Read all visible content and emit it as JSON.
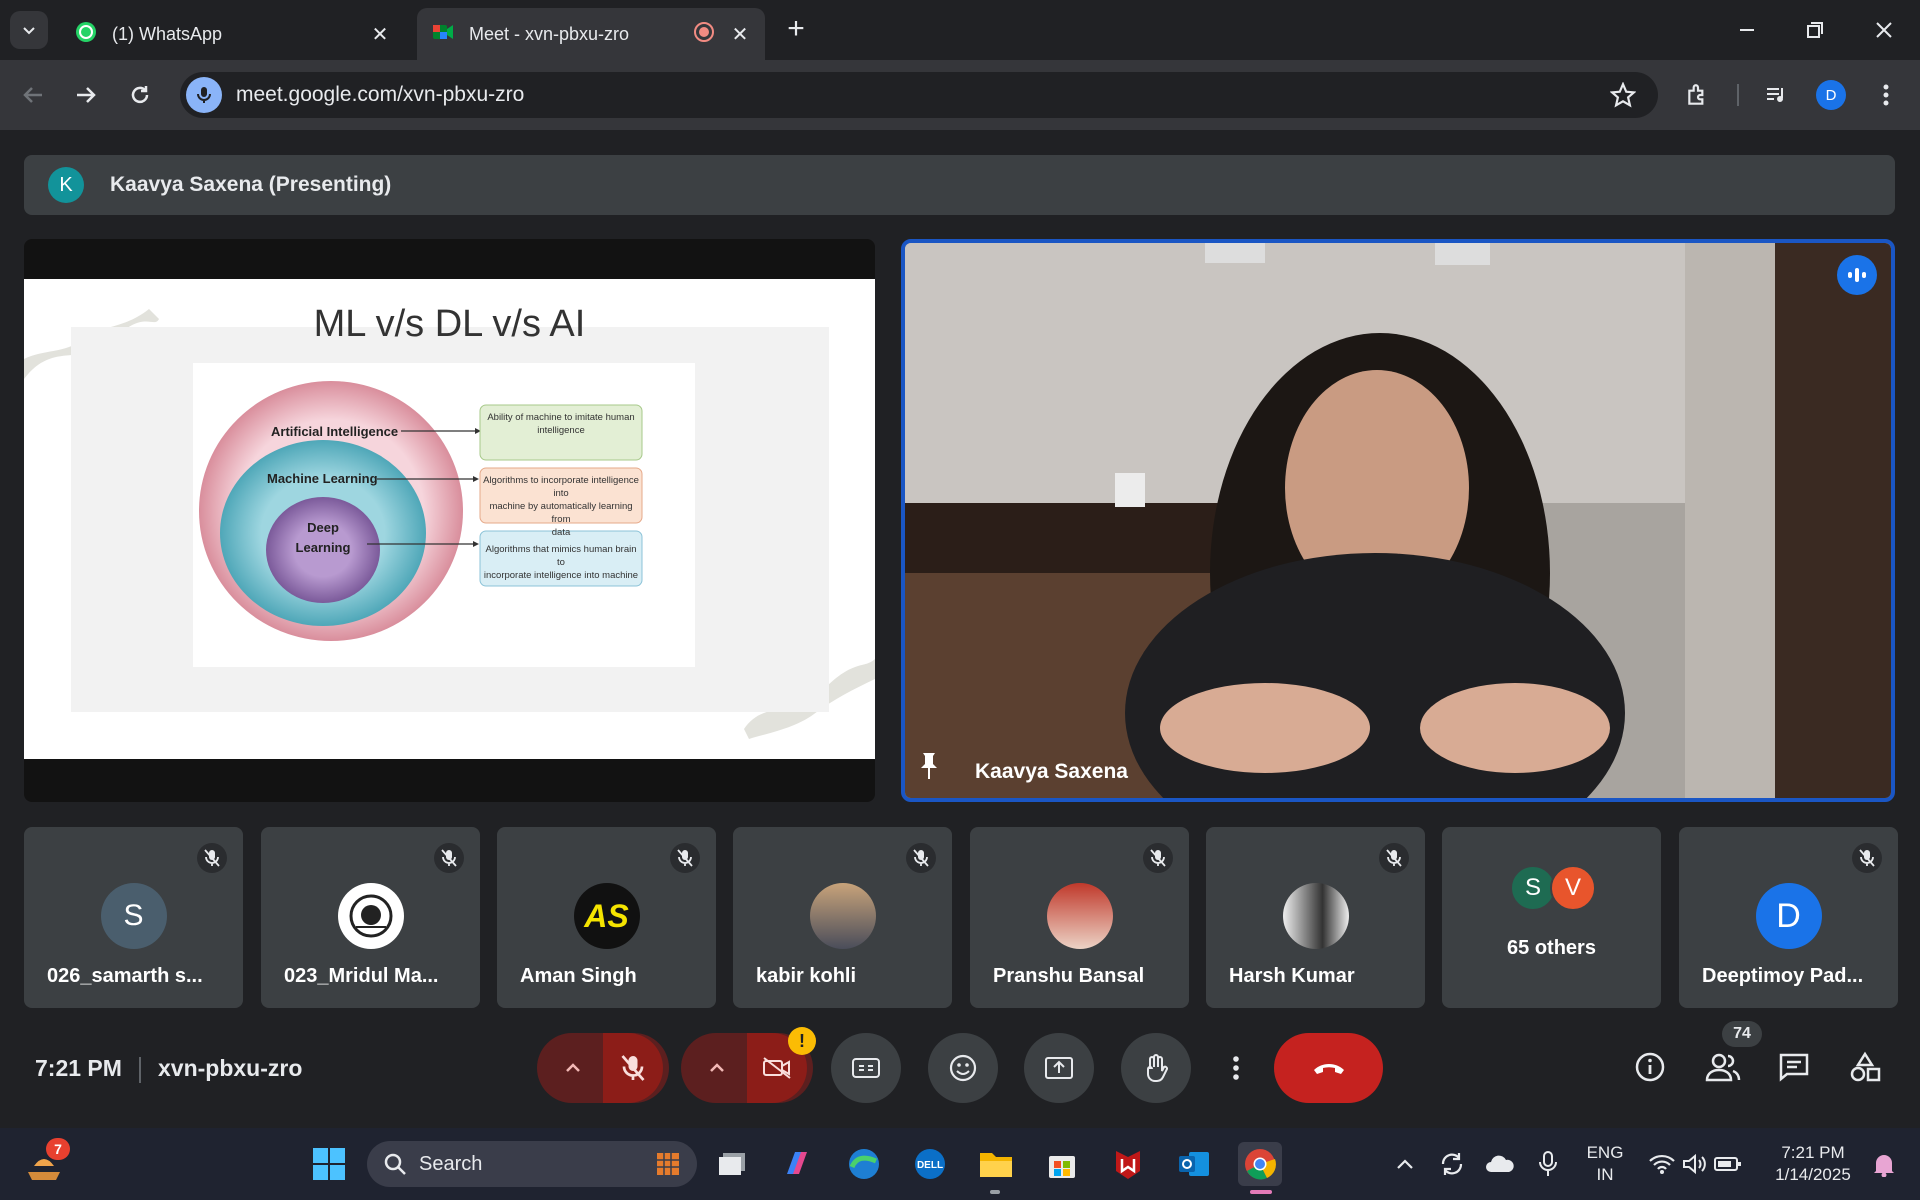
{
  "browser": {
    "tabs": [
      {
        "title": "(1) WhatsApp",
        "icon": "whatsapp-icon"
      },
      {
        "title": "Meet - xvn-pbxu-zro",
        "icon": "google-meet-icon"
      }
    ],
    "url": "meet.google.com/xvn-pbxu-zro",
    "profile_initial": "D"
  },
  "meet": {
    "presenting": {
      "initial": "K",
      "label": "Kaavya Saxena (Presenting)"
    },
    "slide": {
      "title": "ML v/s DL v/s AI",
      "rings": [
        "Artificial Intelligence",
        "Machine Learning",
        "Deep Learning"
      ],
      "deep_line1": "Deep",
      "deep_line2": "Learning",
      "boxes": [
        {
          "line1": "Ability of machine to imitate human",
          "line2": "intelligence",
          "line3": ""
        },
        {
          "line1": "Algorithms to incorporate intelligence into",
          "line2": "machine by automatically learning from",
          "line3": "data"
        },
        {
          "line1": "Algorithms that mimics human brain to",
          "line2": "incorporate intelligence into machine",
          "line3": ""
        }
      ]
    },
    "speaker_name": "Kaavya Saxena",
    "participants": [
      {
        "name": "026_samarth s...",
        "initial": "S",
        "color": "#4a5e6d"
      },
      {
        "name": "023_Mridul Ma...",
        "initial": "",
        "color": "#ffffff"
      },
      {
        "name": "Aman Singh",
        "initial": "AS",
        "color": "#111111"
      },
      {
        "name": "kabir kohli",
        "initial": "",
        "color": "#6b7c8c"
      },
      {
        "name": "Pranshu Bansal",
        "initial": "",
        "color": "#c0392b"
      },
      {
        "name": "Harsh Kumar",
        "initial": "",
        "color": "#dddddd"
      },
      {
        "name": "65 others",
        "initial": "",
        "color": ""
      },
      {
        "name": "Deeptimoy Pad...",
        "initial": "D",
        "color": "#1a73e8"
      }
    ],
    "others": {
      "a": "S",
      "b": "V"
    },
    "time": "7:21 PM",
    "code": "xvn-pbxu-zro",
    "people_count": "74"
  },
  "taskbar": {
    "weather_badge": "7",
    "search_placeholder": "Search",
    "lang_line1": "ENG",
    "lang_line2": "IN",
    "time": "7:21 PM",
    "date": "1/14/2025"
  }
}
